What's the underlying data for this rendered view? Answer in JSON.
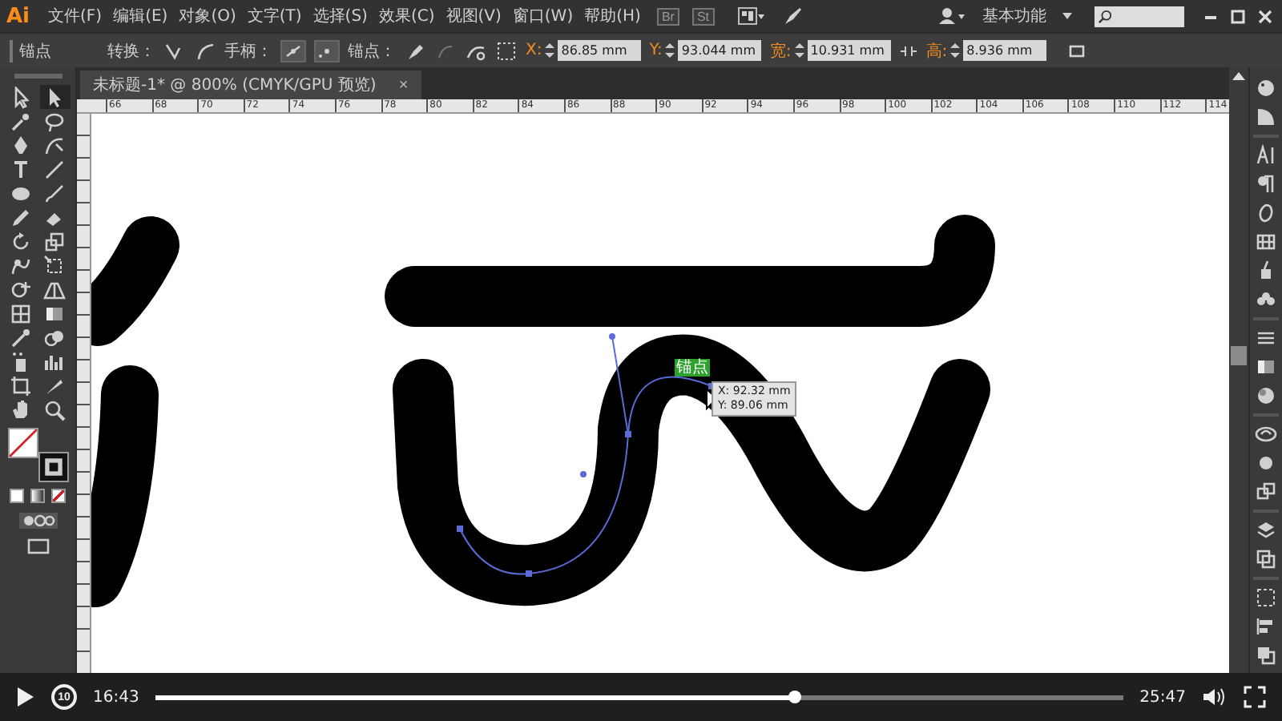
{
  "app_logo": "Ai",
  "menus": [
    "文件(F)",
    "编辑(E)",
    "对象(O)",
    "文字(T)",
    "选择(S)",
    "效果(C)",
    "视图(V)",
    "窗口(W)",
    "帮助(H)"
  ],
  "app_buttons": [
    "Br",
    "St"
  ],
  "workspace": "基本功能",
  "control_bar": {
    "selection_label": "锚点",
    "convert_label": "转换：",
    "handles_label": "手柄：",
    "anchors_label": "锚点：",
    "fields": [
      {
        "label": "X:",
        "value": "86.85 mm"
      },
      {
        "label": "Y:",
        "value": "93.044 mm"
      },
      {
        "label": "宽:",
        "value": "10.931 mm"
      },
      {
        "label": "高:",
        "value": "8.936 mm"
      }
    ]
  },
  "document_tab": {
    "title": "未标题-1* @ 800% (CMYK/GPU 预览)",
    "close": "×",
    "selected": true
  },
  "ruler_marks": [
    "66",
    "68",
    "70",
    "72",
    "74",
    "76",
    "78",
    "80",
    "82",
    "84",
    "86",
    "88",
    "90",
    "92",
    "94",
    "96",
    "98",
    "100",
    "102",
    "104",
    "106",
    "108",
    "110",
    "112",
    "114"
  ],
  "tools": [
    {
      "kind": "select",
      "selected": false
    },
    {
      "kind": "direct-select",
      "selected": true
    },
    {
      "kind": "wand",
      "selected": false
    },
    {
      "kind": "lasso",
      "selected": false
    },
    {
      "kind": "pen",
      "selected": false
    },
    {
      "kind": "curvature",
      "selected": false
    },
    {
      "kind": "type",
      "selected": false
    },
    {
      "kind": "line",
      "selected": false
    },
    {
      "kind": "ellipse",
      "selected": false
    },
    {
      "kind": "brush",
      "selected": false
    },
    {
      "kind": "pencil",
      "selected": false
    },
    {
      "kind": "eraser",
      "selected": false
    },
    {
      "kind": "rotate",
      "selected": false
    },
    {
      "kind": "scale",
      "selected": false
    },
    {
      "kind": "warp",
      "selected": false
    },
    {
      "kind": "free-transform",
      "selected": false
    },
    {
      "kind": "shape-builder",
      "selected": false
    },
    {
      "kind": "perspective",
      "selected": false
    },
    {
      "kind": "mesh",
      "selected": false
    },
    {
      "kind": "gradient",
      "selected": false
    },
    {
      "kind": "eyedropper",
      "selected": false
    },
    {
      "kind": "blend",
      "selected": false
    },
    {
      "kind": "sprayer",
      "selected": false
    },
    {
      "kind": "graph",
      "selected": false
    },
    {
      "kind": "artboard",
      "selected": false
    },
    {
      "kind": "slice",
      "selected": false
    },
    {
      "kind": "hand",
      "selected": false
    },
    {
      "kind": "zoom",
      "selected": false
    }
  ],
  "canvas": {
    "anchor_label": "锚点",
    "tooltip": [
      "X: 92.32 mm",
      "Y: 89.06 mm"
    ]
  },
  "player": {
    "current_time": "16:43",
    "duration": "25:47",
    "replay_label": "10",
    "level": 0.66
  }
}
